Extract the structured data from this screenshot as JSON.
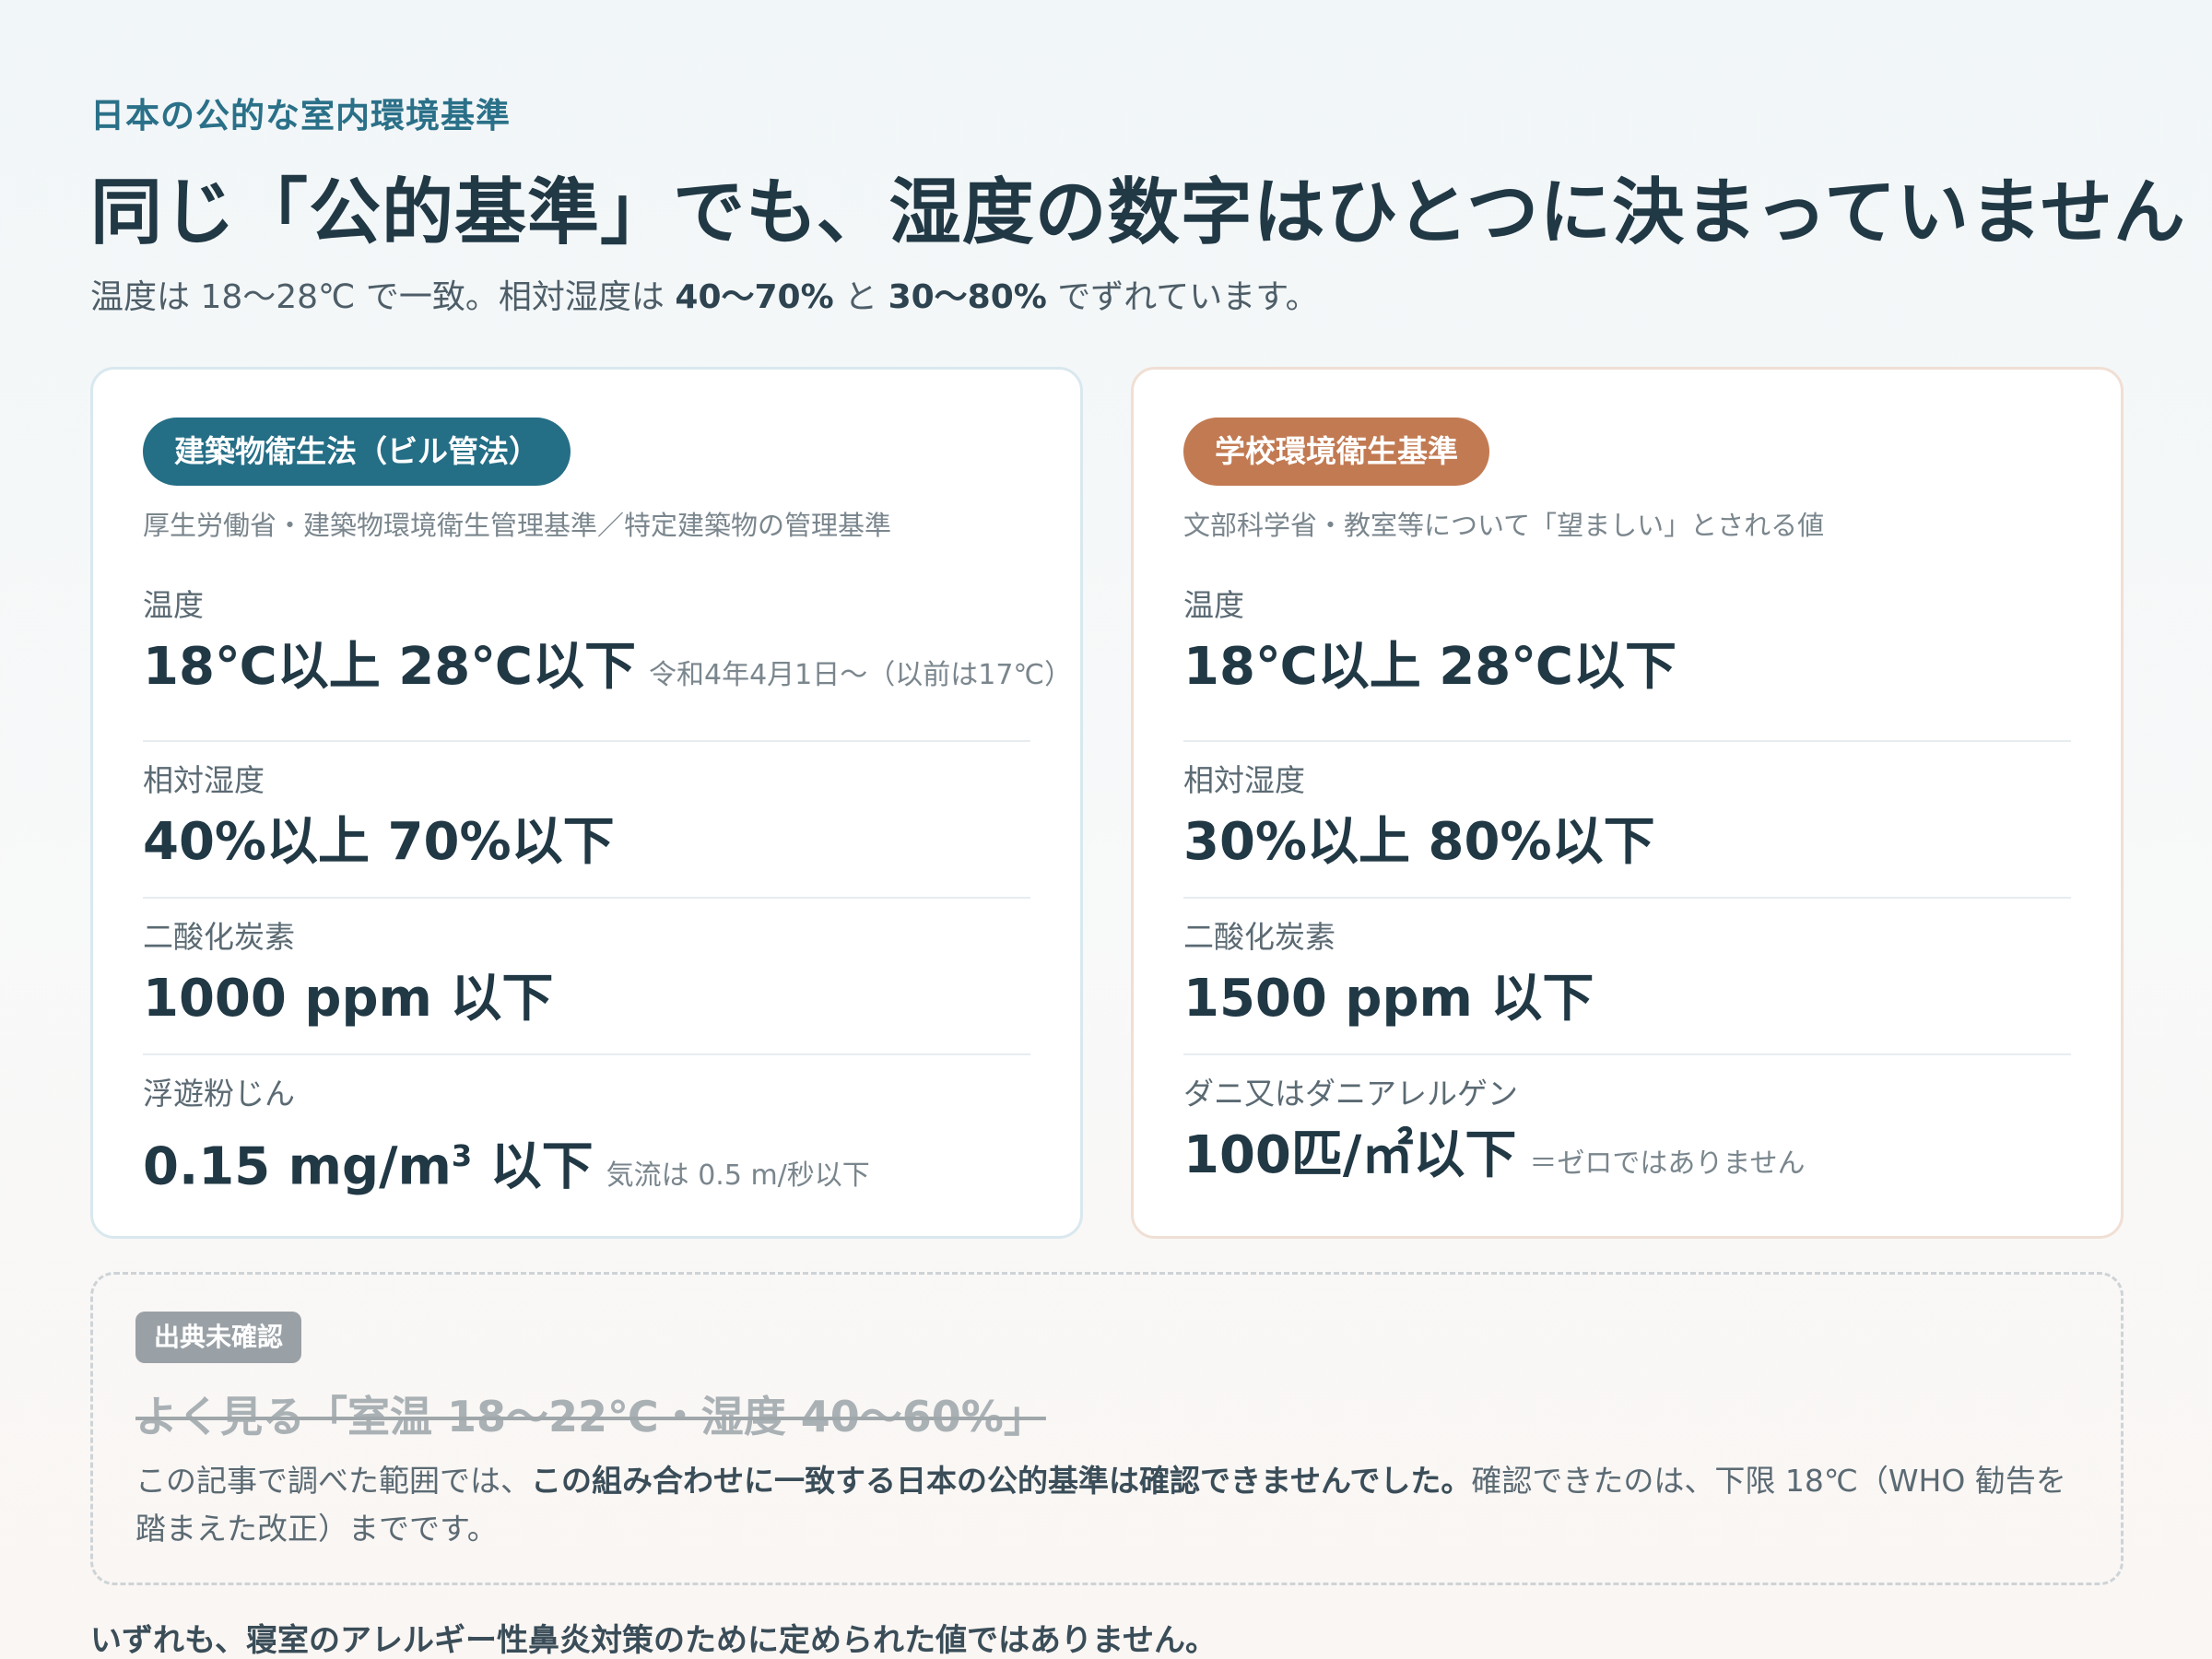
{
  "eyebrow": "日本の公的な室内環境基準",
  "title": "同じ「公的基準」でも、湿度の数字はひとつに決まっていません",
  "subtitle": {
    "p1": "温度は 18〜28℃ で一致。相対湿度は ",
    "b1": "40〜70%",
    "p2": " と ",
    "b2": "30〜80%",
    "p3": " でずれています。"
  },
  "left_card": {
    "badge": "建築物衛生法（ビル管法）",
    "source": "厚生労働省・建築物環境衛生管理基準／特定建築物の管理基準",
    "rows": [
      {
        "label": "温度",
        "value": "18℃以上 28℃以下",
        "note": "令和4年4月1日〜（以前は17℃）"
      },
      {
        "label": "相対湿度",
        "value": "40%以上 70%以下",
        "note": ""
      },
      {
        "label": "二酸化炭素",
        "value": "1000 ppm 以下",
        "note": ""
      },
      {
        "label": "浮遊粉じん",
        "value_main": "0.15 mg/m",
        "value_sup": "3",
        "value_tail": " 以下",
        "note": "気流は 0.5 m/秒以下"
      }
    ]
  },
  "right_card": {
    "badge": "学校環境衛生基準",
    "source": "文部科学省・教室等について「望ましい」とされる値",
    "rows": [
      {
        "label": "温度",
        "value": "18℃以上 28℃以下",
        "note": ""
      },
      {
        "label": "相対湿度",
        "value": "30%以上 80%以下",
        "note": ""
      },
      {
        "label": "二酸化炭素",
        "value": "1500 ppm 以下",
        "note": ""
      },
      {
        "label": "ダニ又はダニアレルゲン",
        "value": "100匹/㎡以下",
        "note": "＝ゼロではありません"
      }
    ]
  },
  "unverified": {
    "tag": "出典未確認",
    "struck": "よく見る「室温 18〜22℃・湿度 40〜60%」",
    "p1": "この記事で調べた範囲では、",
    "b1": "この組み合わせに一致する日本の公的基準は確認できませんでした。",
    "p2": "確認できたのは、下限 18℃（WHO 勧告を踏まえた改正）までです。"
  },
  "footer": "いずれも、寝室のアレルギー性鼻炎対策のために定められた値ではありません。",
  "colors": {
    "accent_blue": "#246e86",
    "accent_orange": "#c27a52",
    "tag_gray": "#9aa1a6"
  }
}
